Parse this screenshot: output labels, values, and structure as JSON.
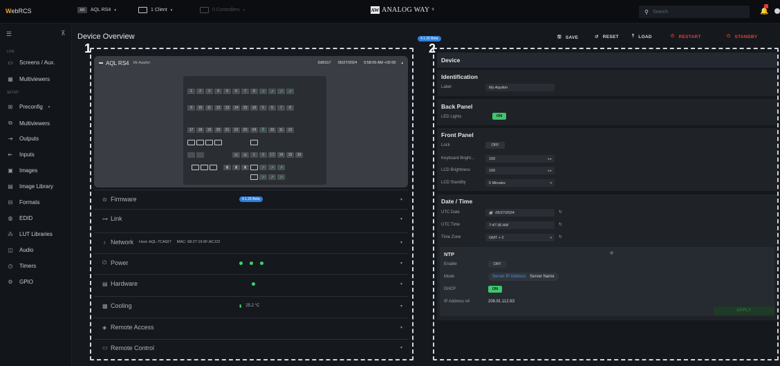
{
  "topbar": {
    "logo_prefix": "W",
    "logo_rest": "ebRCS",
    "device_badge": "AR",
    "device": "AQL RS4",
    "clients": "1 Client",
    "controllers": "0 Controllers",
    "brand_mark": "AW",
    "brand": "ANALOG WAY",
    "search_placeholder": "Search"
  },
  "sidebar": {
    "section_live": "LIVE",
    "section_setup": "SETUP",
    "live_items": [
      {
        "icon": "screens-icon",
        "label": "Screens / Aux."
      },
      {
        "icon": "multiviewers-icon",
        "label": "Multiviewers"
      }
    ],
    "setup_items": [
      {
        "icon": "preconfig-icon",
        "label": "Preconfig"
      },
      {
        "icon": "multiviewers-icon",
        "label": "Multiviewers"
      },
      {
        "icon": "outputs-icon",
        "label": "Outputs"
      },
      {
        "icon": "inputs-icon",
        "label": "Inputs"
      },
      {
        "icon": "images-icon",
        "label": "Images"
      },
      {
        "icon": "image-library-icon",
        "label": "Image Library"
      },
      {
        "icon": "formats-icon",
        "label": "Formats"
      },
      {
        "icon": "edid-icon",
        "label": "EDID"
      },
      {
        "icon": "lut-icon",
        "label": "LUT Libraries"
      },
      {
        "icon": "audio-icon",
        "label": "Audio"
      },
      {
        "icon": "timers-icon",
        "label": "Timers"
      },
      {
        "icon": "gpio-icon",
        "label": "GPIO"
      }
    ]
  },
  "header": {
    "title": "Device Overview",
    "version": "4.1.26 Beta",
    "save": "SAVE",
    "reset": "RESET",
    "load": "LOAD",
    "restart": "RESTART",
    "standby": "STANDBY"
  },
  "callouts": {
    "one": "1",
    "two": "2"
  },
  "device_card": {
    "model": "AQL RS4",
    "label": "My Aquilon",
    "serial": "G80117",
    "date": "05/27/2024",
    "time": "9:58:00 AM +02:00",
    "keys_row1": [
      "1",
      "2",
      "3",
      "4",
      "5",
      "6",
      "7",
      "8"
    ],
    "keys_row2": [
      "9",
      "10",
      "11",
      "12",
      "13",
      "14",
      "15",
      "16",
      "5",
      "6",
      "7",
      "8"
    ],
    "keys_row3": [
      "17",
      "18",
      "19",
      "20",
      "21",
      "22",
      "23",
      "24",
      "9",
      "10",
      "11",
      "12"
    ],
    "keys_row4b": [
      "1",
      "2",
      "13",
      "14",
      "15",
      "16"
    ]
  },
  "sections": [
    {
      "icon": "firmware-icon",
      "label": "Firmware",
      "extra": "4.1.26 Beta"
    },
    {
      "icon": "link-icon",
      "label": "Link",
      "extra": ""
    },
    {
      "icon": "network-icon",
      "label": "Network",
      "host": "Host: AQL-7CA927",
      "mac": "MAC: 68:27:19:9F:AC:D2"
    },
    {
      "icon": "power-icon",
      "label": "Power",
      "dots": 3
    },
    {
      "icon": "hardware-icon",
      "label": "Hardware",
      "dots": 1
    },
    {
      "icon": "cooling-icon",
      "label": "Cooling",
      "temp": "25.2 °C"
    },
    {
      "icon": "remote-access-icon",
      "label": "Remote Access"
    },
    {
      "icon": "remote-control-icon",
      "label": "Remote Control"
    }
  ],
  "device_panel": {
    "title": "Device",
    "identification": {
      "title": "Identification",
      "label_lbl": "Label",
      "label_val": "My Aquilon"
    },
    "back_panel": {
      "title": "Back Panel",
      "led_lbl": "LED Lights",
      "led_val": "ON"
    },
    "front_panel": {
      "title": "Front Panel",
      "lock_lbl": "Lock",
      "lock_val": "OFF",
      "kb_lbl": "Keyboard Bright...",
      "kb_val": "100",
      "lcd_lbl": "LCD Brightness",
      "lcd_val": "100",
      "standby_lbl": "LCD Standby",
      "standby_val": "5 Minutes"
    },
    "datetime": {
      "title": "Date / Time",
      "utc_date_lbl": "UTC Date",
      "utc_date_val": "05/27/2024",
      "utc_time_lbl": "UTC Time",
      "utc_time_val": "7:47:36 AM",
      "tz_lbl": "Time Zone",
      "tz_val": "GMT + 2"
    },
    "ntp": {
      "title": "NTP",
      "enable_lbl": "Enable",
      "enable_val": "OFF",
      "mode_lbl": "Mode",
      "mode_opt1": "Server IP Address",
      "mode_opt2": "Server Name",
      "dhcp_lbl": "DHCP",
      "dhcp_val": "ON",
      "ip_lbl": "IP Address v4",
      "ip_val": "208.91.112.63",
      "apply": "APPLY"
    }
  },
  "colors": {
    "accent_green": "#3fc56a",
    "accent_blue": "#2f7fd8",
    "danger": "#e0433a"
  }
}
